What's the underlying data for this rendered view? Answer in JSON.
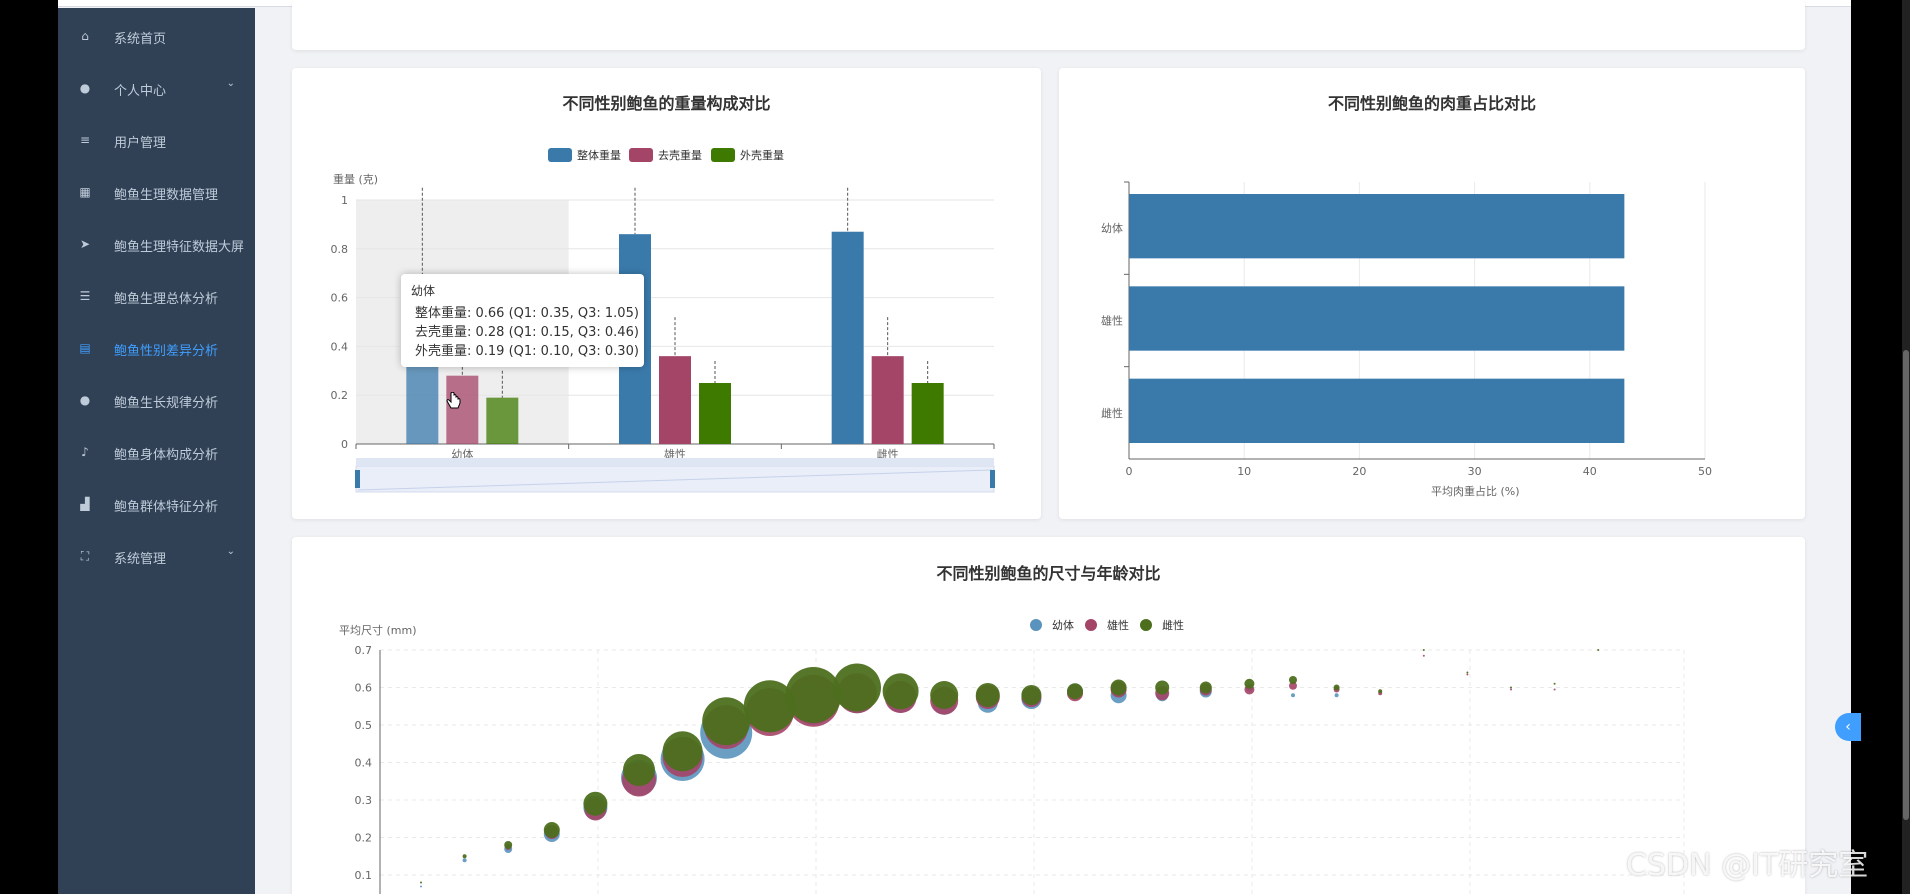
{
  "sidebar": {
    "items": [
      {
        "label": "系统首页",
        "icon": "home-icon",
        "active": false,
        "has_arrow": false
      },
      {
        "label": "个人中心",
        "icon": "user-icon",
        "active": false,
        "has_arrow": true
      },
      {
        "label": "用户管理",
        "icon": "list-icon",
        "active": false,
        "has_arrow": false
      },
      {
        "label": "鲍鱼生理数据管理",
        "icon": "grid-icon",
        "active": false,
        "has_arrow": false
      },
      {
        "label": "鲍鱼生理特征数据大屏",
        "icon": "send-icon",
        "active": false,
        "has_arrow": false
      },
      {
        "label": "鲍鱼生理总体分析",
        "icon": "sliders-icon",
        "active": false,
        "has_arrow": false
      },
      {
        "label": "鲍鱼性别差异分析",
        "icon": "document-icon",
        "active": true,
        "has_arrow": false
      },
      {
        "label": "鲍鱼生长规律分析",
        "icon": "user-icon",
        "active": false,
        "has_arrow": false
      },
      {
        "label": "鲍鱼身体构成分析",
        "icon": "microphone-icon",
        "active": false,
        "has_arrow": false
      },
      {
        "label": "鲍鱼群体特征分析",
        "icon": "chart-icon",
        "active": false,
        "has_arrow": false
      },
      {
        "label": "系统管理",
        "icon": "fullscreen-icon",
        "active": false,
        "has_arrow": true
      }
    ]
  },
  "colors": {
    "sidebar_bg": "#304156",
    "accent": "#409eff",
    "series_blue": "#3a7aab",
    "series_red": "#a44467",
    "series_green": "#3f7a00"
  },
  "charts": {
    "weight": {
      "title": "不同性别鲍鱼的重量构成对比",
      "ylabel": "重量 (克)",
      "legend": [
        "整体重量",
        "去壳重量",
        "外壳重量"
      ],
      "tooltip": {
        "title": "幼体",
        "rows": [
          "整体重量: 0.66 (Q1: 0.35, Q3: 1.05)",
          "去壳重量: 0.28 (Q1: 0.15, Q3: 0.46)",
          "外壳重量: 0.19 (Q1: 0.10, Q3: 0.30)"
        ]
      }
    },
    "meat": {
      "title": "不同性别鲍鱼的肉重占比对比",
      "xlabel": "平均肉重占比 (%)"
    },
    "size_age": {
      "title": "不同性别鲍鱼的尺寸与年龄对比",
      "ylabel": "平均尺寸 (mm)",
      "legend": [
        "幼体",
        "雄性",
        "雌性"
      ]
    }
  },
  "chart_data": [
    {
      "type": "bar",
      "title": "不同性别鲍鱼的重量构成对比",
      "ylabel": "重量 (克)",
      "categories": [
        "幼体",
        "雄性",
        "雌性"
      ],
      "ylim": [
        0,
        1
      ],
      "yticks": [
        0,
        0.2,
        0.4,
        0.6,
        0.8,
        1
      ],
      "series": [
        {
          "name": "整体重量",
          "values": [
            0.66,
            0.86,
            0.87
          ],
          "upper": [
            1.05,
            1.05,
            1.05
          ]
        },
        {
          "name": "去壳重量",
          "values": [
            0.28,
            0.36,
            0.36
          ],
          "upper": [
            0.46,
            0.52,
            0.52
          ]
        },
        {
          "name": "外壳重量",
          "values": [
            0.19,
            0.25,
            0.25
          ],
          "upper": [
            0.3,
            0.34,
            0.34
          ]
        }
      ],
      "legend_position": "top",
      "grid": true
    },
    {
      "type": "bar",
      "orientation": "horizontal",
      "title": "不同性别鲍鱼的肉重占比对比",
      "xlabel": "平均肉重占比 (%)",
      "categories": [
        "幼体",
        "雄性",
        "雌性"
      ],
      "values": [
        43,
        43,
        43
      ],
      "xlim": [
        0,
        50
      ],
      "xticks": [
        0,
        10,
        20,
        30,
        40,
        50
      ],
      "grid": true
    },
    {
      "type": "scatter",
      "title": "不同性别鲍鱼的尺寸与年龄对比",
      "ylabel": "平均尺寸 (mm)",
      "ylim": [
        0,
        0.7
      ],
      "yticks": [
        0.1,
        0.2,
        0.3,
        0.4,
        0.5,
        0.6,
        0.7
      ],
      "x": [
        1,
        2,
        3,
        4,
        5,
        6,
        7,
        8,
        9,
        10,
        11,
        12,
        13,
        14,
        15,
        16,
        17,
        18,
        19,
        20,
        21,
        22,
        23,
        24,
        25,
        26,
        27,
        28,
        29
      ],
      "series": [
        {
          "name": "幼体",
          "values": [
            0.08,
            0.15,
            0.18,
            0.22,
            0.29,
            0.37,
            0.42,
            0.49,
            0.55,
            0.57,
            0.59,
            0.58,
            0.57,
            0.57,
            0.58,
            0.6,
            0.59,
            0.59,
            0.6,
            0.61,
            0.59,
            0.59,
            null,
            null,
            null,
            null,
            null,
            null,
            null
          ],
          "sizes": [
            1,
            2,
            4,
            8,
            12,
            18,
            22,
            26,
            22,
            22,
            18,
            14,
            12,
            10,
            10,
            8,
            8,
            6,
            6,
            4,
            2,
            2,
            null,
            null,
            null,
            null,
            null,
            null,
            null
          ]
        },
        {
          "name": "雄性",
          "values": [
            null,
            null,
            0.18,
            0.22,
            0.28,
            0.36,
            0.42,
            0.5,
            0.54,
            0.57,
            0.59,
            0.58,
            0.57,
            0.58,
            0.58,
            0.59,
            0.6,
            0.59,
            0.6,
            0.6,
            0.61,
            0.6,
            0.59,
            0.69,
            0.64,
            0.6,
            0.6,
            null,
            null
          ],
          "sizes": [
            null,
            null,
            3,
            7,
            11,
            17,
            20,
            22,
            24,
            26,
            20,
            16,
            14,
            12,
            10,
            8,
            8,
            7,
            6,
            5,
            4,
            3,
            2,
            1,
            1,
            1,
            1,
            null,
            null
          ]
        },
        {
          "name": "雌性",
          "values": [
            0.08,
            0.15,
            0.18,
            0.22,
            0.29,
            0.38,
            0.43,
            0.51,
            0.55,
            0.58,
            0.6,
            0.59,
            0.58,
            0.58,
            0.58,
            0.59,
            0.6,
            0.6,
            0.6,
            0.61,
            0.62,
            0.6,
            0.59,
            0.7,
            0.64,
            0.6,
            0.61,
            0.7,
            null
          ],
          "sizes": [
            1,
            2,
            4,
            8,
            12,
            16,
            20,
            24,
            26,
            28,
            24,
            18,
            14,
            12,
            10,
            8,
            8,
            7,
            6,
            5,
            4,
            3,
            2,
            1,
            1,
            1,
            1,
            1,
            null
          ]
        }
      ],
      "legend_position": "top",
      "grid": true
    }
  ],
  "watermark": "CSDN @IT研究室"
}
